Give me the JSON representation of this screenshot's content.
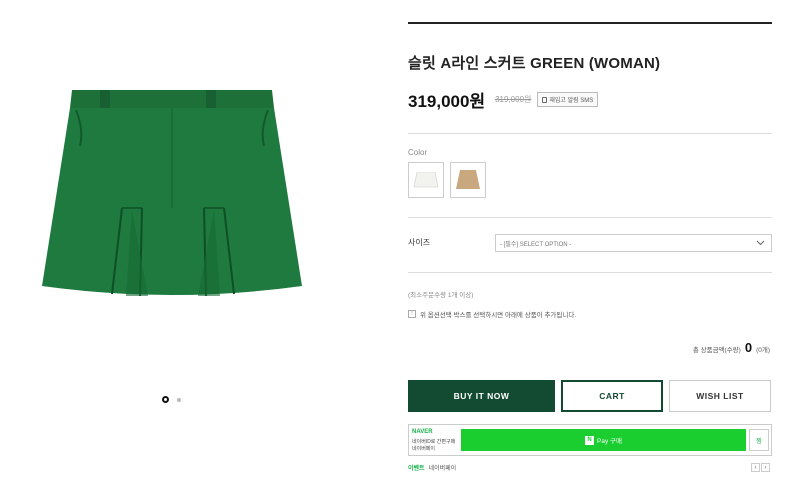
{
  "product": {
    "title": "슬릿 A라인 스커트 GREEN (WOMAN)",
    "price": "319,000원",
    "old_price": "319,000원",
    "sms_label": "재입고 알림 SMS"
  },
  "options": {
    "color_label": "Color",
    "color_swatches": [
      {
        "name": "white",
        "color": "#f2f2ef"
      },
      {
        "name": "beige",
        "color": "#c9a87f"
      }
    ],
    "size_label": "사이즈",
    "size_select": "- [필수] SELECT OPTION -"
  },
  "order": {
    "min_qty": "(최소주문수량 1개 이상)",
    "notice": "위 옵션선택 박스를 선택하시면 아래에 상품이 추가됩니다.",
    "total_label": "총 상품금액(수량)",
    "total_value": "0",
    "total_count": "(0개)"
  },
  "buttons": {
    "buy_now": "BUY IT NOW",
    "cart": "CART",
    "wish_list": "WISH LIST"
  },
  "naver": {
    "brand": "NAVER",
    "line1": "네이버ID로 간편구매",
    "line2": "네이버페이",
    "pay_label": "Pay 구매",
    "side_label": "찜",
    "event_tag": "이벤트",
    "event_text": "네이버페이"
  },
  "colors": {
    "accent": "#134a32",
    "skirt": "#1e7a3e",
    "naver_green": "#19ce2e"
  },
  "gallery": {
    "active_index": 1,
    "count": 2
  }
}
